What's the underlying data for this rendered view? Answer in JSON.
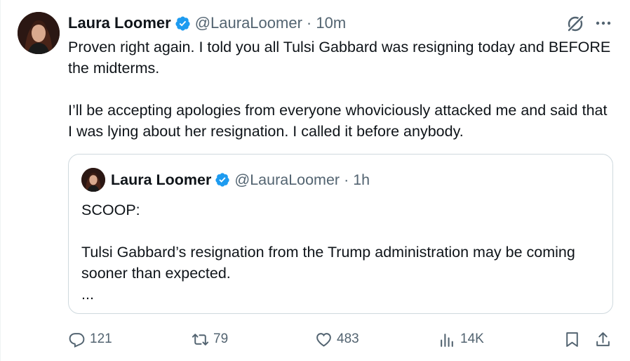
{
  "author": {
    "name": "Laura Loomer",
    "handle": "@LauraLoomer",
    "time": "· 10m",
    "verified_color": "#1d9bf0"
  },
  "tweet": {
    "text": "Proven right again. I told you all Tulsi Gabbard was resigning today and BEFORE the midterms.\n\nI’ll be accepting apologies from everyone whoviciously attacked me and said that I was lying about her resignation. I called it before anybody."
  },
  "quoted": {
    "name": "Laura Loomer",
    "handle": "@LauraLoomer",
    "time": "· 1h",
    "text": "SCOOP:\n\nTulsi Gabbard’s resignation from the Trump administration may be coming sooner than expected.\n..."
  },
  "actions": {
    "replies": "121",
    "retweets": "79",
    "likes": "483",
    "views": "14K"
  },
  "icons": [
    "grok-icon",
    "more-icon",
    "verified-icon",
    "reply-icon",
    "retweet-icon",
    "like-icon",
    "views-icon",
    "bookmark-icon",
    "share-icon"
  ]
}
